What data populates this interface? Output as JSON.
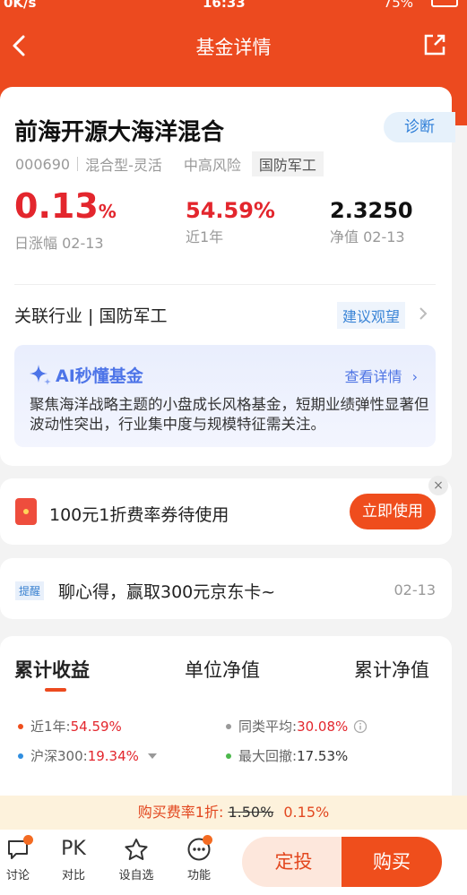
{
  "status_bar": {
    "speed": "0K/s",
    "time": "16:33",
    "battery": "75%"
  },
  "nav": {
    "title": "基金详情"
  },
  "fund": {
    "name": "前海开源大海洋混合",
    "diagnose_label": "诊断",
    "code": "000690",
    "type": "混合型-灵活",
    "risk": "中高风险",
    "sector_tag": "国防军工",
    "daily_change": "0.13",
    "daily_change_unit": "%",
    "daily_change_label": "日涨幅 02-13",
    "year_return": "54.59%",
    "year_return_label": "近1年",
    "nav_value": "2.3250",
    "nav_label": "净值 02-13",
    "industry_text": "关联行业 | 国防军工",
    "advice_label": "建议观望"
  },
  "ai": {
    "title": "AI秒懂基金",
    "more_label": "查看详情",
    "summary": "聚焦海洋战略主题的小盘成长风格基金，短期业绩弹性显著但波动性突出，行业集中度与规模特征需关注。"
  },
  "coupon": {
    "text": "100元1折费率券待使用",
    "button_label": "立即使用",
    "close_label": "×"
  },
  "notice": {
    "tag": "提醒",
    "text": "聊心得，赢取300元京东卡~",
    "date": "02-13"
  },
  "chart_tabs": [
    {
      "label": "累计收益"
    },
    {
      "label": "单位净值"
    },
    {
      "label": "累计净值"
    }
  ],
  "legend": [
    {
      "label": "近1年:",
      "value": "54.59%",
      "color": "#ef4e1c"
    },
    {
      "label": "同类平均:",
      "value": "30.08%",
      "color": "#999999"
    },
    {
      "label": "沪深300:",
      "value": "19.34%",
      "color": "#2f8ee0"
    },
    {
      "label": "最大回撤:",
      "value": "17.53%",
      "color": "#4cb84c"
    }
  ],
  "fee": {
    "prefix": "购买费率1折:",
    "original": "1.50%",
    "discounted": "0.15%"
  },
  "bottom": {
    "discuss": "讨论",
    "compare_icon": "PK",
    "compare": "对比",
    "watchlist": "设自选",
    "functions": "功能",
    "fixed_invest": "定投",
    "buy": "购买"
  }
}
